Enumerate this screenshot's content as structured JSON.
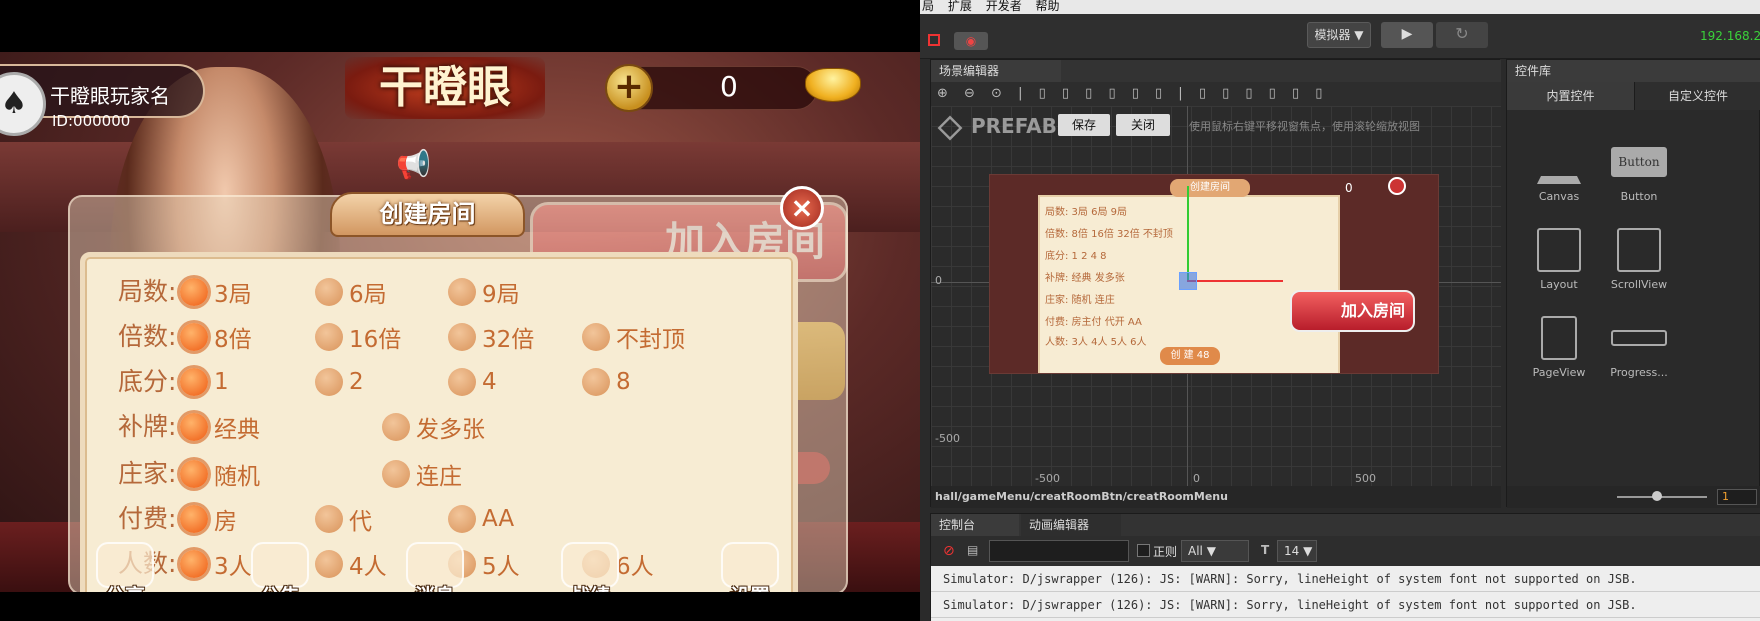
{
  "game": {
    "player": {
      "name": "干瞪眼玩家名",
      "id": "ID:000000",
      "avatar_glyph": "♠"
    },
    "logo": "干瞪眼",
    "plus": "+",
    "coins": "0",
    "dialog": {
      "title": "创建房间",
      "close": "×",
      "rows": [
        {
          "label": "局数:",
          "options": [
            {
              "text": "3局",
              "selected": true
            },
            {
              "text": "6局",
              "selected": false
            },
            {
              "text": "9局",
              "selected": false
            }
          ]
        },
        {
          "label": "倍数:",
          "options": [
            {
              "text": "8倍",
              "selected": true
            },
            {
              "text": "16倍",
              "selected": false
            },
            {
              "text": "32倍",
              "selected": false
            },
            {
              "text": "不封顶",
              "selected": false
            }
          ]
        },
        {
          "label": "底分:",
          "options": [
            {
              "text": "1",
              "selected": true
            },
            {
              "text": "2",
              "selected": false
            },
            {
              "text": "4",
              "selected": false
            },
            {
              "text": "8",
              "selected": false
            }
          ]
        },
        {
          "label": "补牌:",
          "options": [
            {
              "text": "经典",
              "selected": true
            },
            {
              "text": "发多张",
              "selected": false
            }
          ]
        },
        {
          "label": "庄家:",
          "options": [
            {
              "text": "随机",
              "selected": true
            },
            {
              "text": "连庄",
              "selected": false
            }
          ]
        },
        {
          "label": "付费:",
          "options": [
            {
              "text": "房",
              "selected": true
            },
            {
              "text": "代",
              "selected": false
            },
            {
              "text": "AA",
              "selected": false
            }
          ]
        },
        {
          "label": "人数:",
          "options": [
            {
              "text": "3人",
              "selected": true
            },
            {
              "text": "4人",
              "selected": false
            },
            {
              "text": "5人",
              "selected": false
            },
            {
              "text": "6人",
              "selected": false
            }
          ]
        }
      ]
    },
    "join_button": "加入房间",
    "nav": [
      "分享",
      "公告",
      "消息",
      "战绩",
      "设置"
    ]
  },
  "editor": {
    "menu": [
      "局",
      "扩展",
      "开发者",
      "帮助"
    ],
    "simulator_select": "模拟器 ▼",
    "play": "▶",
    "reload": "↻",
    "ip": "192.168.2.",
    "scene": {
      "tab": "场景编辑器",
      "tools": "⊕ ⊖ ⊙ | ▯ ▯ ▯ ▯ ▯ ▯ | ▯ ▯ ▯ ▯ ▯ ▯",
      "prefab": "PREFAB",
      "save": "保存",
      "close": "关闭",
      "hint": "使用鼠标右键平移视窗焦点，使用滚轮缩放视图",
      "axis_labels": [
        "0",
        "-500",
        "-500",
        "0",
        "500"
      ],
      "breadcrumb": "hall/gameMenu/creatRoomBtn/creatRoomMenu",
      "mini": {
        "title": "创建房间",
        "coins": "0",
        "join": "加入房间",
        "create": "创 建 48",
        "rows": [
          "局数: 3局 6局 9局",
          "倍数: 8倍 16倍 32倍 不封顶",
          "底分: 1 2 4 8",
          "补牌: 经典 发多张",
          "庄家: 随机 连庄",
          "付费: 房主付 代开 AA",
          "人数: 3人 4人 5人 6人"
        ]
      }
    },
    "widgets": {
      "tab": "控件库",
      "tabs": [
        "内置控件",
        "自定义控件"
      ],
      "items": [
        "Canvas",
        "Button",
        "Layout",
        "ScrollView",
        "PageView",
        "Progress..."
      ],
      "button_preview": "Button",
      "zoom": "1"
    },
    "console": {
      "tabs": [
        "控制台",
        "动画编辑器"
      ],
      "regex": "正则",
      "level": "All ▼",
      "font_size": "14 ▼",
      "lines": [
        "Simulator: D/jswrapper (126): JS: [WARN]: Sorry, lineHeight of system font not supported on JSB.",
        "Simulator: D/jswrapper (126): JS: [WARN]: Sorry, lineHeight of system font not supported on JSB."
      ]
    }
  }
}
